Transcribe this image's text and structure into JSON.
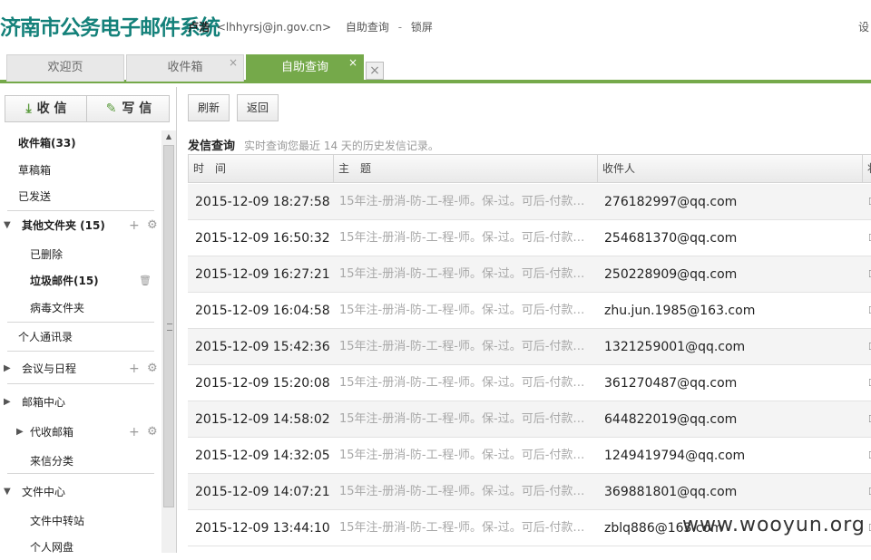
{
  "header": {
    "logo": "济南市公务电子邮件系统",
    "user_name": "卢浩",
    "user_email": "<lhhyrsj@jn.gov.cn>",
    "link_query": "自助查询",
    "sep": "-",
    "link_lock": "锁屏",
    "right_link": "设"
  },
  "tabs": [
    {
      "label": "欢迎页",
      "closable": false
    },
    {
      "label": "收件箱",
      "closable": true,
      "close": "×"
    },
    {
      "label": "自助查询",
      "closable": true,
      "close": "×",
      "active": true
    }
  ],
  "tab_extra": "×",
  "sidebar": {
    "receive_label": "收 信",
    "receive_icon": "⤓",
    "write_label": "写 信",
    "write_icon": "✎",
    "items": [
      {
        "label": "收件箱(33)",
        "bold": true
      },
      {
        "label": "草稿箱"
      },
      {
        "label": "已发送"
      },
      {
        "label": "其他文件夹 (15)",
        "bold": true,
        "arrow": "▼",
        "add": "+",
        "gear": "⚙"
      },
      {
        "label": "已删除"
      },
      {
        "label": "垃圾邮件(15)",
        "bold": true,
        "trash": "🗑"
      },
      {
        "label": "病毒文件夹"
      },
      {
        "label": "个人通讯录"
      },
      {
        "label": "会议与日程",
        "arrow": "▶",
        "add": "+",
        "gear": "⚙"
      },
      {
        "label": "邮箱中心",
        "arrow": "▶"
      },
      {
        "label": "代收邮箱",
        "arrow": "▶",
        "add": "+",
        "gear": "⚙"
      },
      {
        "label": "来信分类"
      },
      {
        "label": "文件中心",
        "arrow": "▼"
      },
      {
        "label": "文件中转站"
      },
      {
        "label": "个人网盘"
      }
    ],
    "scroll_up": "▲"
  },
  "toolbar": {
    "refresh": "刷新",
    "back": "返回"
  },
  "section": {
    "title": "发信查询",
    "subtitle": "实时查询您最近 14 天的历史发信记录。"
  },
  "table": {
    "headers": [
      "时　间",
      "主　题",
      "收件人",
      "状"
    ],
    "rows": [
      {
        "time": "2015-12-09 18:27:58",
        "subject": "15年注-册消-防-工-程-师。保-过。可后-付款…",
        "to": "276182997@qq.com"
      },
      {
        "time": "2015-12-09 16:50:32",
        "subject": "15年注-册消-防-工-程-师。保-过。可后-付款…",
        "to": "254681370@qq.com"
      },
      {
        "time": "2015-12-09 16:27:21",
        "subject": "15年注-册消-防-工-程-师。保-过。可后-付款…",
        "to": "250228909@qq.com"
      },
      {
        "time": "2015-12-09 16:04:58",
        "subject": "15年注-册消-防-工-程-师。保-过。可后-付款…",
        "to": "zhu.jun.1985@163.com"
      },
      {
        "time": "2015-12-09 15:42:36",
        "subject": "15年注-册消-防-工-程-师。保-过。可后-付款…",
        "to": "1321259001@qq.com"
      },
      {
        "time": "2015-12-09 15:20:08",
        "subject": "15年注-册消-防-工-程-师。保-过。可后-付款…",
        "to": "361270487@qq.com"
      },
      {
        "time": "2015-12-09 14:58:02",
        "subject": "15年注-册消-防-工-程-师。保-过。可后-付款…",
        "to": "644822019@qq.com"
      },
      {
        "time": "2015-12-09 14:32:05",
        "subject": "15年注-册消-防-工-程-师。保-过。可后-付款…",
        "to": "1249419794@qq.com"
      },
      {
        "time": "2015-12-09 14:07:21",
        "subject": "15年注-册消-防-工-程-师。保-过。可后-付款…",
        "to": "369881801@qq.com"
      },
      {
        "time": "2015-12-09 13:44:10",
        "subject": "15年注-册消-防-工-程-师。保-过。可后-付款…",
        "to": "zblq886@163.com"
      }
    ],
    "status_icon": "☐"
  },
  "watermark": "www.wooyun.org",
  "colors": {
    "accent": "#75a94a",
    "logo": "#14817a"
  }
}
